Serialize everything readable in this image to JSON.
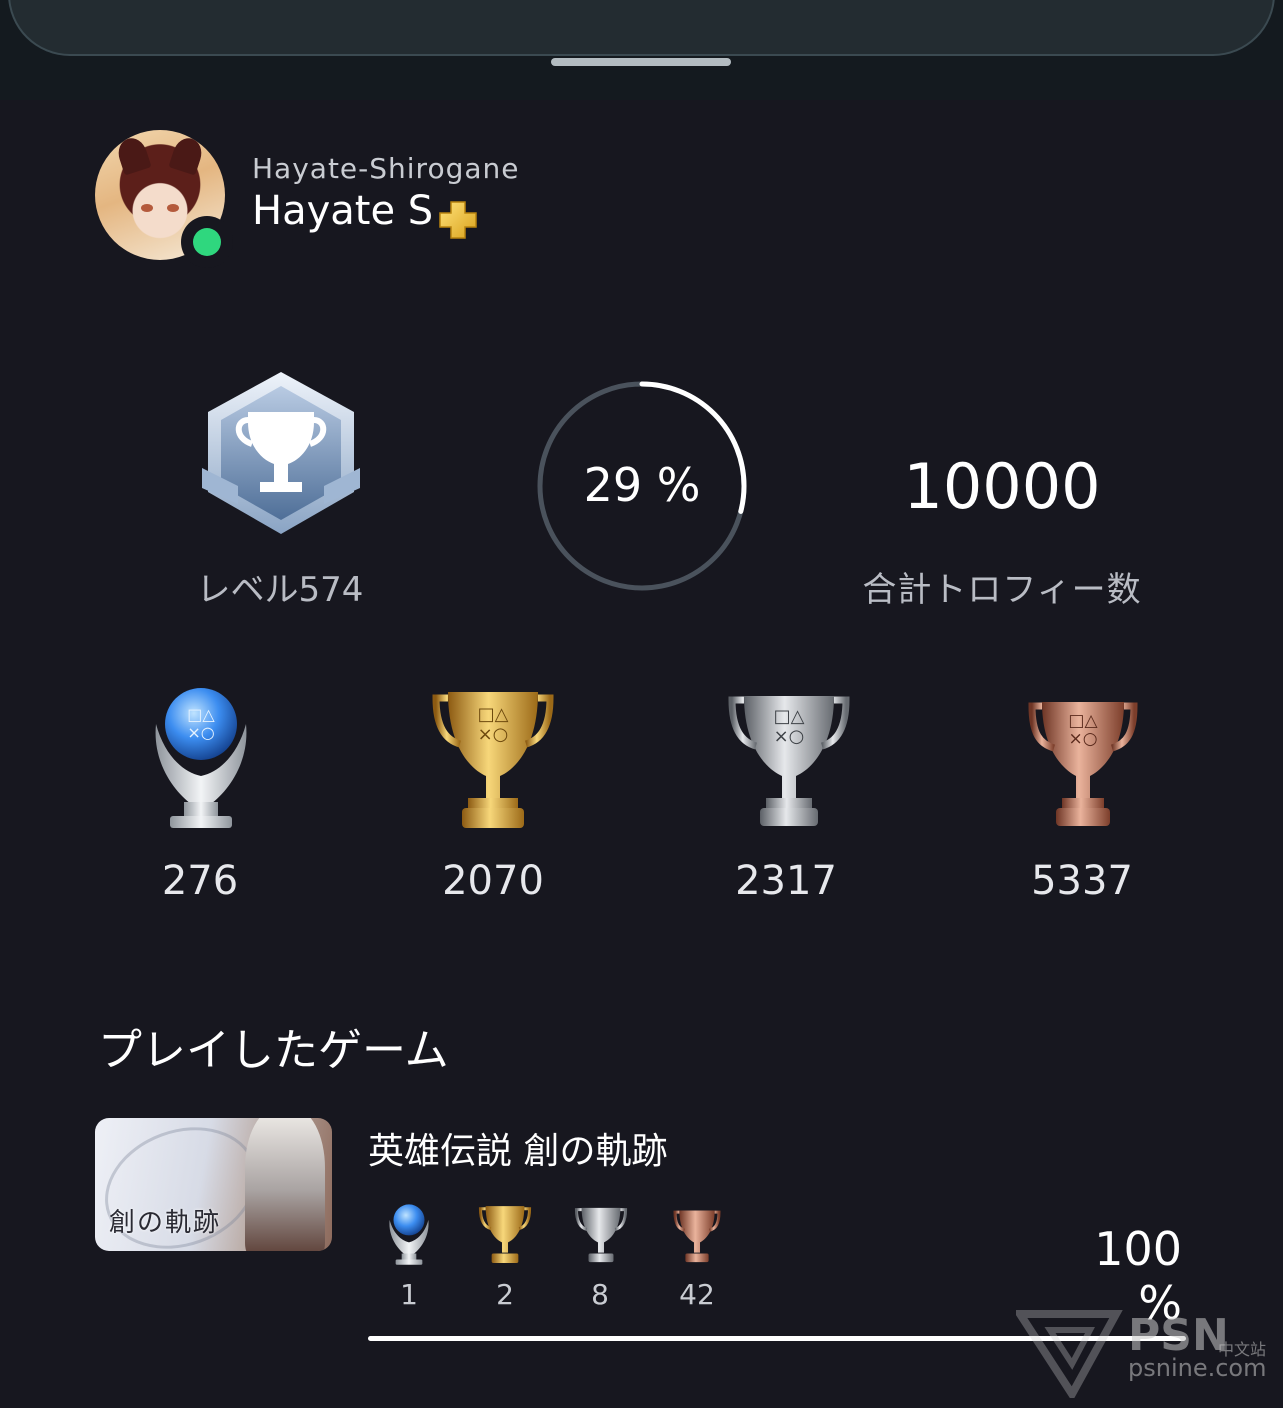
{
  "profile": {
    "online_id": "Hayate-Shirogane",
    "display_name": "Hayate S",
    "online_status_color": "#2fd77e",
    "plus_icon": "ps-plus-icon"
  },
  "stats": {
    "level_label": "レベル574",
    "progress_fraction": 0.29,
    "progress_label": "29 %",
    "total_trophies": "10000",
    "total_label": "合計トロフィー数"
  },
  "trophies": [
    {
      "type": "platinum",
      "count": "276"
    },
    {
      "type": "gold",
      "count": "2070"
    },
    {
      "type": "silver",
      "count": "2317"
    },
    {
      "type": "bronze",
      "count": "5337"
    }
  ],
  "games_section": {
    "title": "プレイしたゲーム",
    "games": [
      {
        "title": "英雄伝説 創の軌跡",
        "cover_logo": "創の軌跡",
        "trophies": [
          {
            "type": "platinum",
            "count": "1"
          },
          {
            "type": "gold",
            "count": "2"
          },
          {
            "type": "silver",
            "count": "8"
          },
          {
            "type": "bronze",
            "count": "42"
          }
        ],
        "progress_label": "100 %",
        "progress_fraction": 1.0
      }
    ]
  },
  "watermark": {
    "brand": "PSN",
    "brand_suffix": "中文站",
    "url": "psnine.com"
  },
  "colors": {
    "background": "#17171f",
    "gold": "#d9a53a",
    "silver": "#a7abb1",
    "bronze": "#b06d55",
    "platinum": "#5aa8ff"
  }
}
